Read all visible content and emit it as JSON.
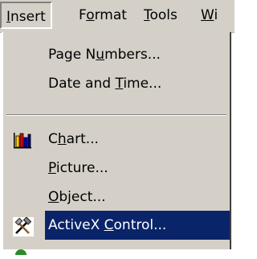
{
  "menubar": {
    "items": [
      {
        "label": "Insert",
        "mnemonic_index": 0
      },
      {
        "label": "Format",
        "mnemonic_index": 1
      },
      {
        "label": "Tools",
        "mnemonic_index": 0
      },
      {
        "label": "Wi",
        "mnemonic_index": 0
      }
    ],
    "active_item": "Insert"
  },
  "dropdown": {
    "items": [
      {
        "label": "Page Numbers...",
        "mnemonic_index": 6
      },
      {
        "label": "Date and Time...",
        "mnemonic_index": 9
      },
      {
        "label": "Chart...",
        "mnemonic_index": 1,
        "icon": "chart-icon"
      },
      {
        "label": "Picture...",
        "mnemonic_index": 0
      },
      {
        "label": "Object...",
        "mnemonic_index": 0
      },
      {
        "label": "ActiveX Control...",
        "mnemonic_index": 8,
        "icon": "activex-control-icon",
        "highlighted": true
      }
    ]
  },
  "colors": {
    "menu_bg": "#d4d0c8",
    "highlight": "#0a246a",
    "highlight_text": "#ffffff"
  }
}
